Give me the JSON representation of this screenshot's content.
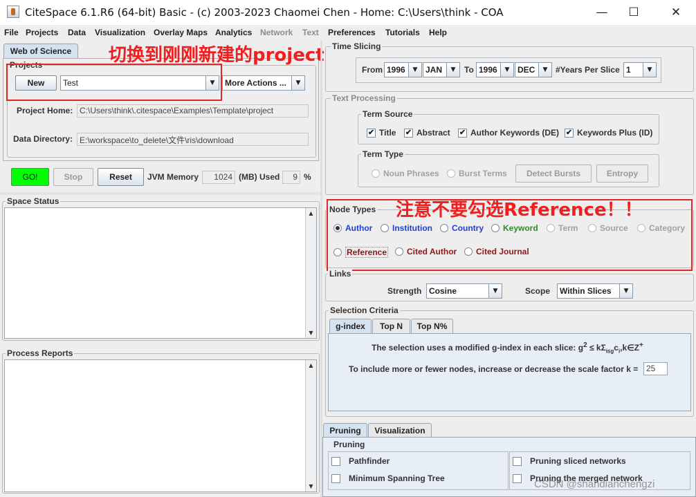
{
  "window": {
    "title": "CiteSpace 6.1.R6 (64-bit) Basic - (c) 2003-2023 Chaomei Chen - Home: C:\\Users\\think - COA",
    "minimize_glyph": "—",
    "maximize_glyph": "☐",
    "close_glyph": "✕"
  },
  "menubar": [
    "File",
    "Projects",
    "Data",
    "Visualization",
    "Overlay Maps",
    "Analytics",
    "Network",
    "Text",
    "Preferences",
    "Tutorials",
    "Help"
  ],
  "left": {
    "tab": "Web of Science",
    "projects": {
      "title": "Projects",
      "new_button": "New",
      "project_selected": "Test",
      "more_actions": "More Actions ...",
      "home_label": "Project Home:",
      "home_value": "C:\\Users\\think\\.citespace\\Examples\\Template\\project",
      "data_label": "Data Directory:",
      "data_value": "E:\\workspace\\to_delete\\文件\\ris\\download"
    },
    "controls": {
      "go": "GO!",
      "stop": "Stop",
      "reset": "Reset",
      "jvm_label": "JVM Memory",
      "jvm_value": "1024",
      "mb_used_label": "(MB) Used",
      "used_value": "9",
      "percent": "%"
    },
    "space_status_title": "Space Status",
    "process_reports_title": "Process Reports"
  },
  "time_slicing": {
    "title": "Time Slicing",
    "from_label": "From",
    "from_year": "1996",
    "from_month": "JAN",
    "to_label": "To",
    "to_year": "1996",
    "to_month": "DEC",
    "years_per_slice_label": "#Years Per Slice",
    "years_per_slice": "1"
  },
  "text_processing": {
    "title": "Text Processing",
    "term_source_title": "Term Source",
    "term_sources": [
      {
        "label": "Title",
        "checked": true
      },
      {
        "label": "Abstract",
        "checked": true
      },
      {
        "label": "Author Keywords (DE)",
        "checked": true
      },
      {
        "label": "Keywords Plus (ID)",
        "checked": true
      }
    ],
    "term_type_title": "Term Type",
    "noun_phrases": "Noun Phrases",
    "burst_terms": "Burst Terms",
    "detect_bursts": "Detect Bursts",
    "entropy": "Entropy",
    "check_glyph": "✔"
  },
  "node_types": {
    "title": "Node Types",
    "row1": [
      "Author",
      "Institution",
      "Country",
      "Keyword",
      "Term",
      "Source",
      "Category"
    ],
    "row2": [
      "Reference",
      "Cited Author",
      "Cited Journal"
    ],
    "selected": "Author"
  },
  "links": {
    "title": "Links",
    "strength_label": "Strength",
    "strength_value": "Cosine",
    "scope_label": "Scope",
    "scope_value": "Within Slices"
  },
  "selection_criteria": {
    "title": "Selection Criteria",
    "tabs": [
      "g-index",
      "Top N",
      "Top N%"
    ],
    "active_tab": "g-index",
    "desc_prefix": "The selection uses a modified g-index in each slice: g",
    "sup2": "2",
    "le_k": " ≤ k",
    "sigma": "Σ",
    "sigma_sub": "i≤g",
    "c": "c",
    "c_sub": "i",
    "k_in_z": ",k∈Z",
    "plus": "+",
    "scale_text": "To include more or fewer nodes, increase or decrease the scale factor k =",
    "scale_value": "25"
  },
  "bottom_tabs": [
    "Pruning",
    "Visualization"
  ],
  "pruning": {
    "title": "Pruning",
    "items_left": [
      "Pathfinder",
      "Minimum Spanning Tree"
    ],
    "items_right": [
      "Pruning sliced networks",
      "Pruning the merged network"
    ]
  },
  "annotations": {
    "project_note": "切换到刚刚新建的project",
    "reference_note": "注意不要勾选Reference！！"
  },
  "watermark": "CSDN @shandianchengzi",
  "colors": {
    "go_green": "#00ff00",
    "annotation_red": "#f01e1e",
    "tab_selected": "#d5e3f1"
  },
  "icons": {
    "dropdown": "▼",
    "scroll_up": "▲",
    "scroll_down": "▼"
  }
}
